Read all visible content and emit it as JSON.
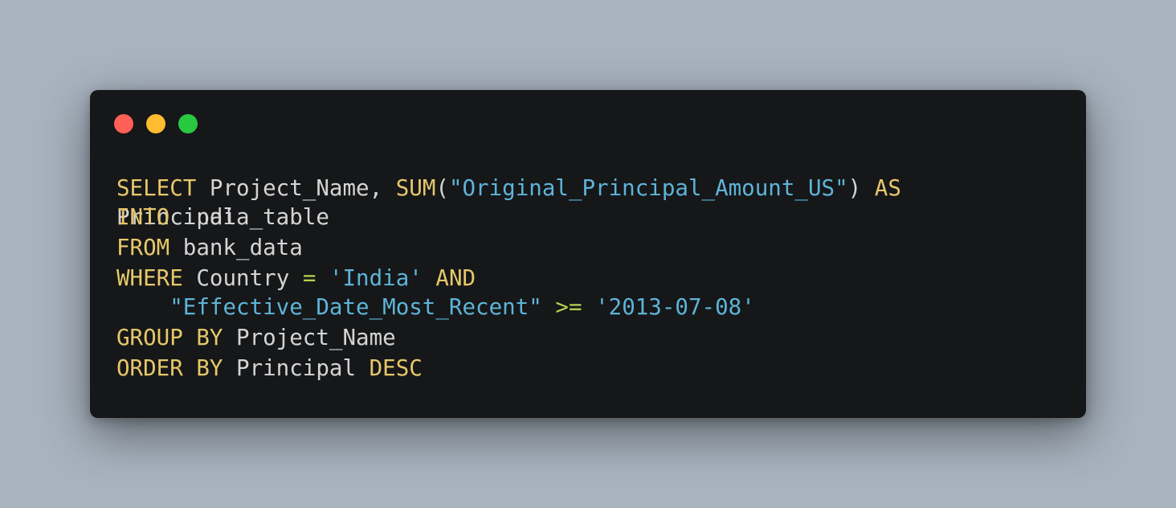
{
  "colors": {
    "background": "#a8b3bf",
    "window": "#161719",
    "dot_red": "#fe5f57",
    "dot_yellow": "#febc2e",
    "dot_green": "#28c840",
    "keyword": "#e6c86a",
    "identifier": "#d4d4d4",
    "string": "#5db4d8",
    "operator": "#b5d14f"
  },
  "code": {
    "lines": [
      {
        "tokens": [
          {
            "text": "SELECT",
            "type": "keyword"
          },
          {
            "text": " Project_Name, ",
            "type": "identifier"
          },
          {
            "text": "SUM",
            "type": "keyword"
          },
          {
            "text": "(",
            "type": "identifier"
          },
          {
            "text": "\"Original_Principal_Amount_US\"",
            "type": "string"
          },
          {
            "text": ") ",
            "type": "identifier"
          },
          {
            "text": "AS",
            "type": "keyword"
          }
        ]
      },
      {
        "tokens": [
          {
            "text": "Principal",
            "type": "identifier"
          }
        ]
      },
      {
        "tokens": [
          {
            "text": "INTO",
            "type": "keyword"
          },
          {
            "text": " india_table",
            "type": "identifier"
          }
        ]
      },
      {
        "tokens": [
          {
            "text": "FROM",
            "type": "keyword"
          },
          {
            "text": " bank_data",
            "type": "identifier"
          }
        ]
      },
      {
        "tokens": [
          {
            "text": "WHERE",
            "type": "keyword"
          },
          {
            "text": " Country ",
            "type": "identifier"
          },
          {
            "text": "=",
            "type": "operator"
          },
          {
            "text": " ",
            "type": "identifier"
          },
          {
            "text": "'India'",
            "type": "string"
          },
          {
            "text": " ",
            "type": "identifier"
          },
          {
            "text": "AND",
            "type": "keyword"
          }
        ]
      },
      {
        "tokens": [
          {
            "text": "    ",
            "type": "identifier"
          },
          {
            "text": "\"Effective_Date_Most_Recent\"",
            "type": "string"
          },
          {
            "text": " ",
            "type": "identifier"
          },
          {
            "text": ">=",
            "type": "operator"
          },
          {
            "text": " ",
            "type": "identifier"
          },
          {
            "text": "'2013-07-08'",
            "type": "string"
          }
        ]
      },
      {
        "tokens": [
          {
            "text": "GROUP BY",
            "type": "keyword"
          },
          {
            "text": " Project_Name",
            "type": "identifier"
          }
        ]
      },
      {
        "tokens": [
          {
            "text": "ORDER BY",
            "type": "keyword"
          },
          {
            "text": " Principal ",
            "type": "identifier"
          },
          {
            "text": "DESC",
            "type": "keyword"
          }
        ]
      }
    ]
  }
}
